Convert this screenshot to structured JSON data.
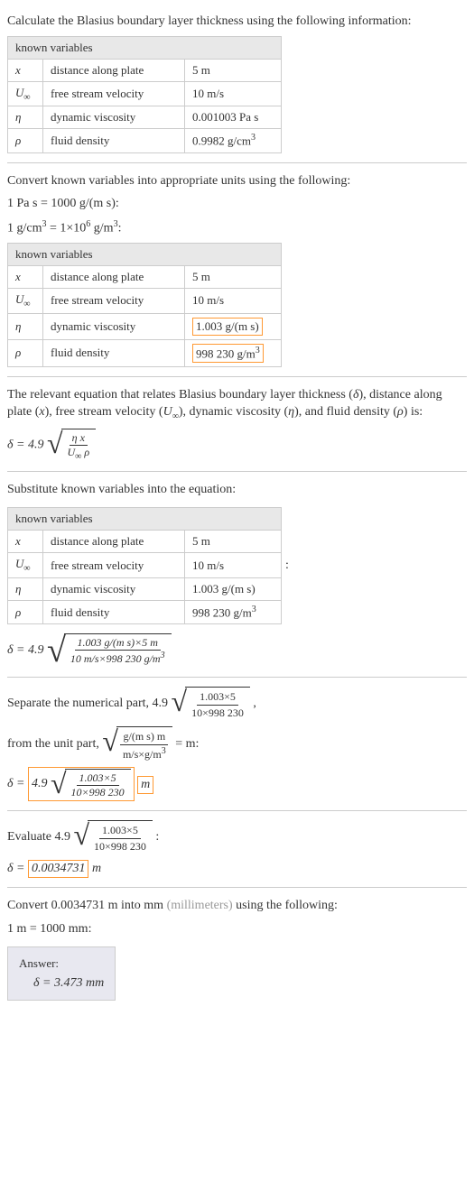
{
  "intro": "Calculate the Blasius boundary layer thickness using the following information:",
  "table1": {
    "header": "known variables",
    "rows": [
      {
        "sym": "x",
        "desc": "distance along plate",
        "val": "5 m"
      },
      {
        "sym": "U∞",
        "desc": "free stream velocity",
        "val": "10 m/s"
      },
      {
        "sym": "η",
        "desc": "dynamic viscosity",
        "val": "0.001003 Pa s"
      },
      {
        "sym": "ρ",
        "desc": "fluid density",
        "val": "0.9982 g/cm³"
      }
    ]
  },
  "step2": {
    "line1": "Convert known variables into appropriate units using the following:",
    "line2": "1 Pa s = 1000 g/(m s):",
    "line3": "1 g/cm³ = 1×10⁶ g/m³:"
  },
  "table2": {
    "header": "known variables",
    "rows": [
      {
        "sym": "x",
        "desc": "distance along plate",
        "val": "5 m",
        "highlight": false
      },
      {
        "sym": "U∞",
        "desc": "free stream velocity",
        "val": "10 m/s",
        "highlight": false
      },
      {
        "sym": "η",
        "desc": "dynamic viscosity",
        "val": "1.003 g/(m s)",
        "highlight": true
      },
      {
        "sym": "ρ",
        "desc": "fluid density",
        "val": "998 230 g/m³",
        "highlight": true
      }
    ]
  },
  "step3": {
    "text": "The relevant equation that relates Blasius boundary layer thickness (δ), distance along plate (x), free stream velocity (U∞), dynamic viscosity (η), and fluid density (ρ) is:",
    "eq_lhs": "δ = 4.9",
    "frac_num": "η x",
    "frac_den": "U∞ ρ"
  },
  "step4": {
    "text": "Substitute known variables into the equation:",
    "colon": ":"
  },
  "table3": {
    "header": "known variables",
    "rows": [
      {
        "sym": "x",
        "desc": "distance along plate",
        "val": "5 m"
      },
      {
        "sym": "U∞",
        "desc": "free stream velocity",
        "val": "10 m/s"
      },
      {
        "sym": "η",
        "desc": "dynamic viscosity",
        "val": "1.003 g/(m s)"
      },
      {
        "sym": "ρ",
        "desc": "fluid density",
        "val": "998 230 g/m³"
      }
    ]
  },
  "eq4": {
    "lhs": "δ = 4.9",
    "num": "1.003 g/(m s)×5 m",
    "den": "10 m/s×998 230 g/m³"
  },
  "step5": {
    "line1a": "Separate the numerical part, 4.9",
    "num1": "1.003×5",
    "den1": "10×998 230",
    "line1b": " ,",
    "line2a": "from the unit part, ",
    "num2": "g/(m s) m",
    "den2": "m/s×g/m³",
    "line2b": " = m:",
    "eq_lhs": "δ = ",
    "eq_coef": "4.9",
    "eq_num": "1.003×5",
    "eq_den": "10×998 230",
    "eq_unit": "m"
  },
  "step6": {
    "line1a": "Evaluate 4.9",
    "num": "1.003×5",
    "den": "10×998 230",
    "line1b": " :",
    "eq_lhs": "δ = ",
    "eq_val": "0.0034731",
    "eq_unit": " m"
  },
  "step7": {
    "line1": "Convert 0.0034731 m into mm ",
    "gray": "(millimeters)",
    "line1b": " using the following:",
    "line2": "1 m = 1000 mm:"
  },
  "answer": {
    "label": "Answer:",
    "value": "δ = 3.473 mm"
  }
}
